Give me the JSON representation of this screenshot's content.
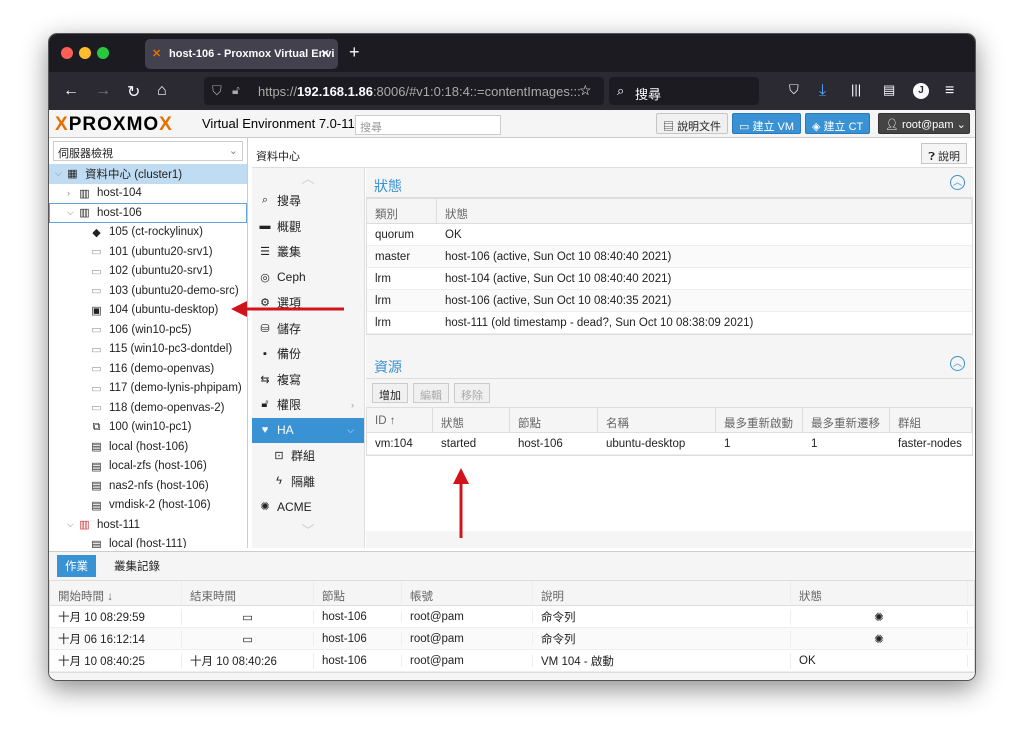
{
  "browser": {
    "tab_title": "host-106 - Proxmox Virtual Envi",
    "url_prefix": "https://",
    "url_host": "192.168.1.86",
    "url_rest": ":8006/#v1:0:18:4::=contentImages:::",
    "search_label": "搜尋"
  },
  "header": {
    "logo_a": "PRO",
    "logo_x1": "X",
    "logo_b": "MO",
    "logo_x2": "X",
    "version": "Virtual Environment 7.0-11",
    "search_placeholder": "搜尋",
    "docs_label": "說明文件",
    "create_vm_label": "建立 VM",
    "create_ct_label": "建立 CT",
    "user_label": "root@pam"
  },
  "tree": {
    "view_selector": "伺服器檢視",
    "items": [
      {
        "label": "資料中心 (cluster1)",
        "icon": "datacenter-icon"
      },
      {
        "label": "host-104",
        "icon": "server-icon"
      },
      {
        "label": "host-106",
        "icon": "server-icon"
      },
      {
        "label": "105 (ct-rockylinux)",
        "icon": "container-icon"
      },
      {
        "label": "101 (ubuntu20-srv1)",
        "icon": "vm-icon"
      },
      {
        "label": "102 (ubuntu20-srv1)",
        "icon": "vm-icon"
      },
      {
        "label": "103 (ubuntu20-demo-src)",
        "icon": "vm-icon"
      },
      {
        "label": "104 (ubuntu-desktop)",
        "icon": "vm-running-icon"
      },
      {
        "label": "106 (win10-pc5)",
        "icon": "vm-icon"
      },
      {
        "label": "115 (win10-pc3-dontdel)",
        "icon": "vm-icon"
      },
      {
        "label": "116 (demo-openvas)",
        "icon": "vm-icon"
      },
      {
        "label": "117 (demo-lynis-phpipam)",
        "icon": "vm-icon"
      },
      {
        "label": "118 (demo-openvas-2)",
        "icon": "vm-icon"
      },
      {
        "label": "100 (win10-pc1)",
        "icon": "template-icon"
      },
      {
        "label": "local (host-106)",
        "icon": "storage-icon"
      },
      {
        "label": "local-zfs (host-106)",
        "icon": "storage-icon"
      },
      {
        "label": "nas2-nfs (host-106)",
        "icon": "storage-icon"
      },
      {
        "label": "vmdisk-2 (host-106)",
        "icon": "storage-icon"
      },
      {
        "label": "host-111",
        "icon": "server-offline-icon"
      },
      {
        "label": "local (host-111)",
        "icon": "storage-icon"
      }
    ]
  },
  "breadcrumb": "資料中心",
  "help_label": "說明",
  "menu": [
    {
      "label": "搜尋",
      "icon": "search-icon"
    },
    {
      "label": "概觀",
      "icon": "book-icon"
    },
    {
      "label": "叢集",
      "icon": "cluster-icon"
    },
    {
      "label": "Ceph",
      "icon": "ceph-icon"
    },
    {
      "label": "選項",
      "icon": "gear-icon"
    },
    {
      "label": "儲存",
      "icon": "database-icon"
    },
    {
      "label": "備份",
      "icon": "floppy-icon"
    },
    {
      "label": "複寫",
      "icon": "retweet-icon"
    },
    {
      "label": "權限",
      "icon": "unlock-icon"
    },
    {
      "label": "HA",
      "icon": "heartbeat-icon"
    },
    {
      "label": "群組",
      "icon": "object-group-icon"
    },
    {
      "label": "隔離",
      "icon": "bolt-icon"
    },
    {
      "label": "ACME",
      "icon": "certificate-icon"
    }
  ],
  "status_panel": {
    "title": "狀態",
    "columns": [
      "類別",
      "狀態"
    ],
    "rows": [
      [
        "quorum",
        "OK"
      ],
      [
        "master",
        "host-106 (active, Sun Oct 10 08:40:40 2021)"
      ],
      [
        "lrm",
        "host-104 (active, Sun Oct 10 08:40:40 2021)"
      ],
      [
        "lrm",
        "host-106 (active, Sun Oct 10 08:40:35 2021)"
      ],
      [
        "lrm",
        "host-111 (old timestamp - dead?, Sun Oct 10 08:38:09 2021)"
      ]
    ]
  },
  "resources_panel": {
    "title": "資源",
    "buttons": {
      "add": "增加",
      "edit": "編輯",
      "remove": "移除"
    },
    "columns": [
      "ID ↑",
      "狀態",
      "節點",
      "名稱",
      "最多重新啟動",
      "最多重新遷移",
      "群組"
    ],
    "rows": [
      [
        "vm:104",
        "started",
        "host-106",
        "ubuntu-desktop",
        "1",
        "1",
        "faster-nodes"
      ]
    ]
  },
  "tasks": {
    "tab_tasks": "作業",
    "tab_cluster_log": "叢集記錄",
    "columns": [
      "開始時間 ↓",
      "結束時間",
      "節點",
      "帳號",
      "說明",
      "狀態"
    ],
    "rows": [
      [
        "十月 10 08:29:59",
        "",
        "host-106",
        "root@pam",
        "命令列",
        ""
      ],
      [
        "十月 06 16:12:14",
        "",
        "host-106",
        "root@pam",
        "命令列",
        ""
      ],
      [
        "十月 10 08:40:25",
        "十月 10 08:40:26",
        "host-106",
        "root@pam",
        "VM 104 - 啟動",
        "OK"
      ]
    ]
  },
  "colors": {
    "accent": "#3892d4",
    "brand": "#e57000",
    "arrow": "#d0141c"
  }
}
